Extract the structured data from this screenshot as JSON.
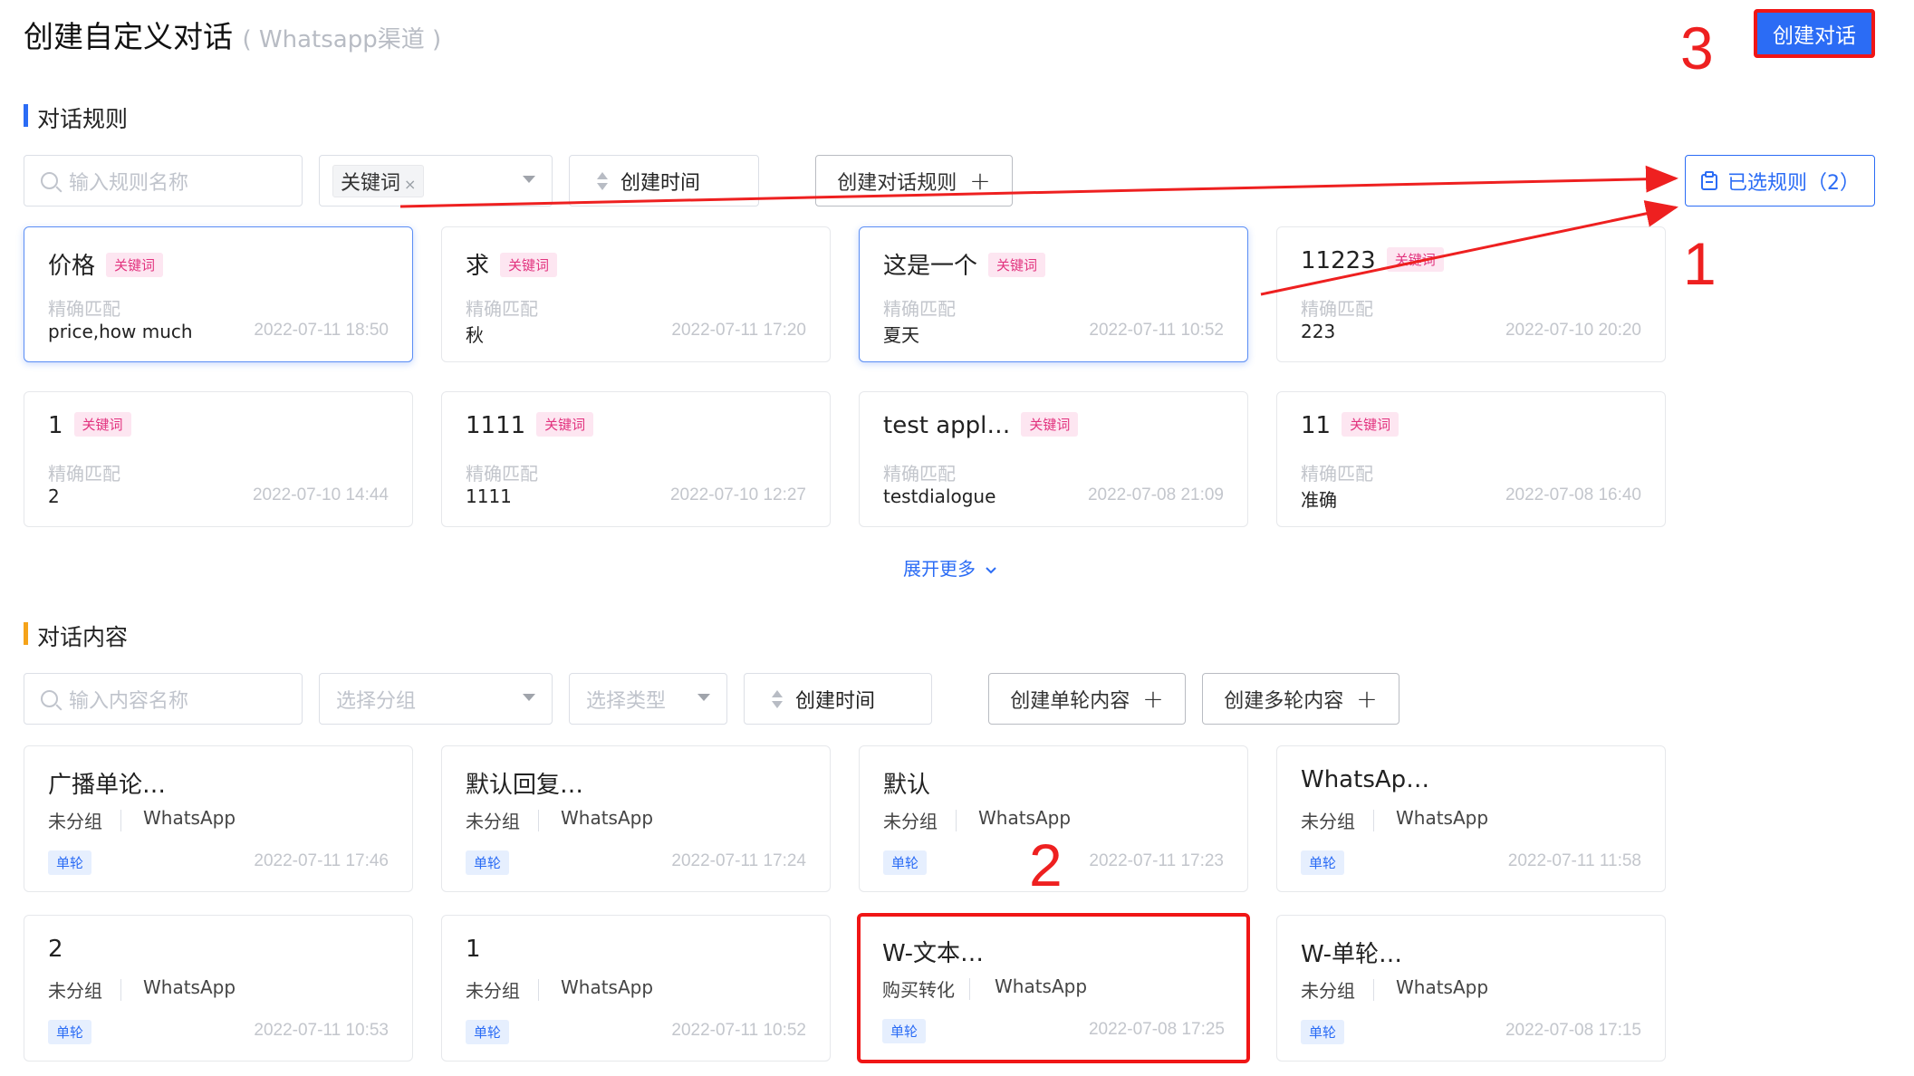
{
  "header": {
    "title": "创建自定义对话",
    "subtitle": "( Whatsapp渠道 )",
    "create_button": "创建对话"
  },
  "annotations": {
    "step1": "1",
    "step2": "2",
    "step3": "3"
  },
  "rules_section": {
    "title": "对话规则",
    "search_placeholder": "输入规则名称",
    "type_filter_value": "关键词",
    "sort_label": "创建时间",
    "create_button": "创建对话规则",
    "selected_button": "已选规则（2）",
    "expand_label": "展开更多",
    "cards": [
      {
        "title": "价格",
        "tag": "关键词",
        "match": "精确匹配",
        "value": "price,how much",
        "date": "2022-07-11 18:50",
        "selected": true
      },
      {
        "title": "求",
        "tag": "关键词",
        "match": "精确匹配",
        "value": "秋",
        "date": "2022-07-11 17:20",
        "selected": false
      },
      {
        "title": "这是一个",
        "tag": "关键词",
        "match": "精确匹配",
        "value": "夏天",
        "date": "2022-07-11 10:52",
        "selected": true
      },
      {
        "title": "11223",
        "tag": "关键词",
        "match": "精确匹配",
        "value": "223",
        "date": "2022-07-10 20:20",
        "selected": false
      },
      {
        "title": "1",
        "tag": "关键词",
        "match": "精确匹配",
        "value": "2",
        "date": "2022-07-10 14:44",
        "selected": false
      },
      {
        "title": "1111",
        "tag": "关键词",
        "match": "精确匹配",
        "value": "1111",
        "date": "2022-07-10 12:27",
        "selected": false
      },
      {
        "title": "test appl…",
        "tag": "关键词",
        "match": "精确匹配",
        "value": "testdialogue",
        "date": "2022-07-08 21:09",
        "selected": false
      },
      {
        "title": "11",
        "tag": "关键词",
        "match": "精确匹配",
        "value": "准确",
        "date": "2022-07-08 16:40",
        "selected": false
      }
    ]
  },
  "content_section": {
    "title": "对话内容",
    "search_placeholder": "输入内容名称",
    "group_placeholder": "选择分组",
    "type_placeholder": "选择类型",
    "sort_label": "创建时间",
    "create_single_button": "创建单轮内容",
    "create_multi_button": "创建多轮内容",
    "cards": [
      {
        "title": "广播单论…",
        "group": "未分组",
        "channel": "WhatsApp",
        "badge": "单轮",
        "date": "2022-07-11 17:46"
      },
      {
        "title": "默认回复…",
        "group": "未分组",
        "channel": "WhatsApp",
        "badge": "单轮",
        "date": "2022-07-11 17:24"
      },
      {
        "title": "默认",
        "group": "未分组",
        "channel": "WhatsApp",
        "badge": "单轮",
        "date": "2022-07-11 17:23"
      },
      {
        "title": "WhatsAp…",
        "group": "未分组",
        "channel": "WhatsApp",
        "badge": "单轮",
        "date": "2022-07-11 11:58"
      },
      {
        "title": "2",
        "group": "未分组",
        "channel": "WhatsApp",
        "badge": "单轮",
        "date": "2022-07-11 10:53"
      },
      {
        "title": "1",
        "group": "未分组",
        "channel": "WhatsApp",
        "badge": "单轮",
        "date": "2022-07-11 10:52"
      },
      {
        "title": "W-文本…",
        "group": "购买转化",
        "channel": "WhatsApp",
        "badge": "单轮",
        "date": "2022-07-08 17:25"
      },
      {
        "title": "W-单轮…",
        "group": "未分组",
        "channel": "WhatsApp",
        "badge": "单轮",
        "date": "2022-07-08 17:15"
      }
    ]
  },
  "colors": {
    "primary": "#2b6cf5",
    "annotation": "#ee2020",
    "keyword_tag": "#e2347f",
    "section_orange": "#f5a31a"
  },
  "icons": {
    "search": "search-icon",
    "sort": "sort-icon",
    "plus": "plus-icon",
    "caret": "caret-down-icon",
    "clipboard": "clipboard-icon"
  }
}
